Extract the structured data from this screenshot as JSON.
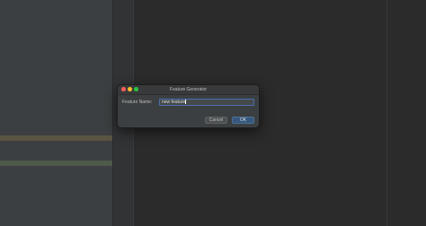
{
  "dialog": {
    "title": "Feature Generator",
    "field_label": "Feature Name:",
    "field_value": "new feature",
    "cancel_label": "Cancel",
    "ok_label": "OK"
  },
  "colors": {
    "background": "#2b2b2b",
    "panel": "#3c3f41",
    "accent": "#365880",
    "focus_border": "#4b6eaf"
  }
}
